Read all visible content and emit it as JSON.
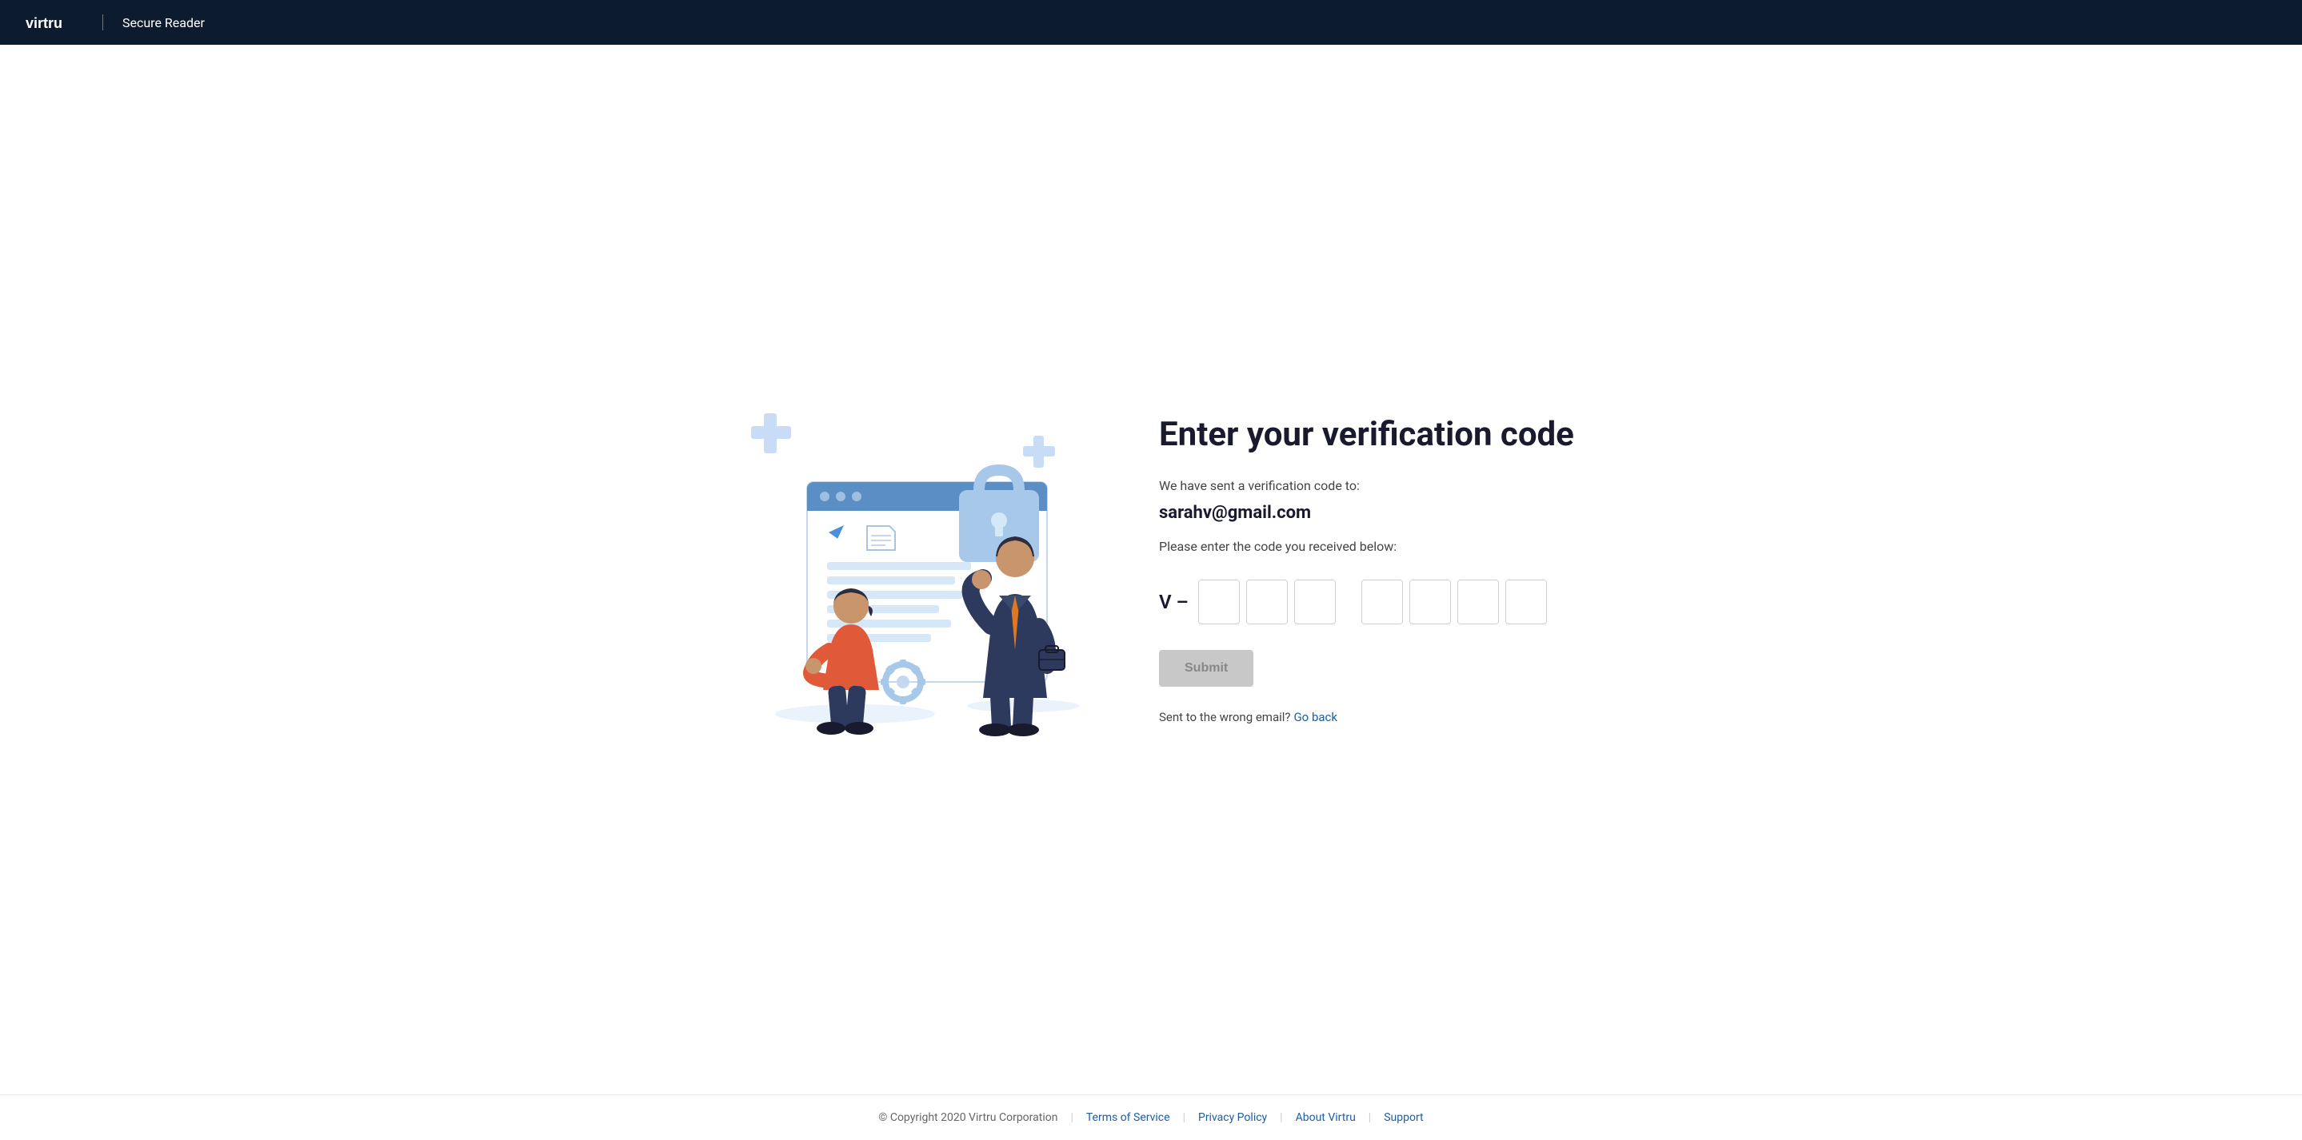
{
  "header": {
    "logo_text": "virtru",
    "app_name": "Secure Reader"
  },
  "main": {
    "title": "Enter your verification code",
    "subtitle": "We have sent a verification code to:",
    "email": "sarahv@gmail.com",
    "instruction": "Please enter the code you received below:",
    "code_prefix": "V –",
    "submit_label": "Submit",
    "wrong_email_text": "Sent to the wrong email?",
    "go_back_label": "Go back",
    "code_inputs": [
      "",
      "",
      "",
      "",
      "",
      "",
      ""
    ]
  },
  "footer": {
    "copyright": "© Copyright 2020 Virtru Corporation",
    "links": [
      {
        "label": "Terms of Service",
        "href": "#"
      },
      {
        "label": "Privacy Policy",
        "href": "#"
      },
      {
        "label": "About Virtru",
        "href": "#"
      },
      {
        "label": "Support",
        "href": "#"
      }
    ]
  }
}
